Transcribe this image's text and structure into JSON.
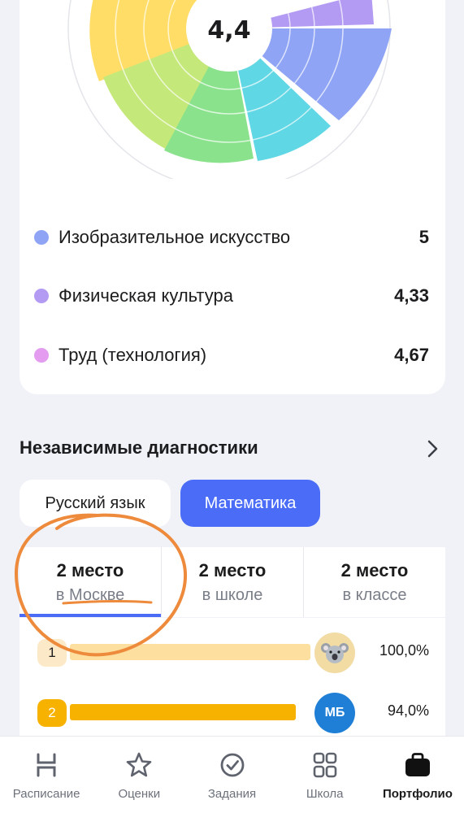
{
  "chart": {
    "center_value": "4,4",
    "legend": [
      {
        "label": "Изобразительное искусство",
        "value": "5",
        "color": "#8fa4f5"
      },
      {
        "label": "Физическая культура",
        "value": "4,33",
        "color": "#b39af2"
      },
      {
        "label": "Труд (технология)",
        "value": "4,67",
        "color": "#e39cf0"
      }
    ]
  },
  "diagnostics": {
    "title": "Независимые диагностики",
    "subjects": [
      {
        "label": "Русский язык",
        "active": false
      },
      {
        "label": "Математика",
        "active": true
      }
    ],
    "places": [
      {
        "title": "2 место",
        "subtitle": "в Москве",
        "selected": true
      },
      {
        "title": "2 место",
        "subtitle": "в школе",
        "selected": false
      },
      {
        "title": "2 место",
        "subtitle": "в классе",
        "selected": false
      }
    ],
    "ranking": [
      {
        "rank": "1",
        "percent": "100,0%",
        "fraction": 1.0,
        "avatar": "koala",
        "color": "#fde0a0",
        "badge_color": "#fbe9c8",
        "badge_text_color": "#1c1c1e"
      },
      {
        "rank": "2",
        "percent": "94,0%",
        "fraction": 0.94,
        "avatar": "МБ",
        "color": "#f7b200",
        "badge_color": "#f7b200",
        "badge_text_color": "#ffffff"
      }
    ]
  },
  "nav": [
    {
      "label": "Расписание",
      "icon": "schedule-icon"
    },
    {
      "label": "Оценки",
      "icon": "star-icon"
    },
    {
      "label": "Задания",
      "icon": "check-circle-icon"
    },
    {
      "label": "Школа",
      "icon": "grid-icon"
    },
    {
      "label": "Портфолио",
      "icon": "briefcase-icon",
      "current": true
    }
  ]
}
